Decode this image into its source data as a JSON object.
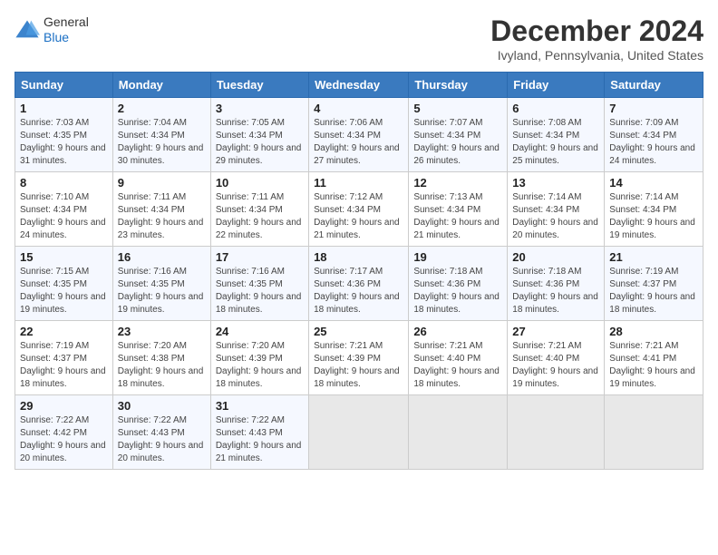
{
  "header": {
    "logo_line1": "General",
    "logo_line2": "Blue",
    "title": "December 2024",
    "subtitle": "Ivyland, Pennsylvania, United States"
  },
  "days_of_week": [
    "Sunday",
    "Monday",
    "Tuesday",
    "Wednesday",
    "Thursday",
    "Friday",
    "Saturday"
  ],
  "weeks": [
    [
      {
        "day": "1",
        "sunrise": "7:03 AM",
        "sunset": "4:35 PM",
        "daylight": "9 hours and 31 minutes."
      },
      {
        "day": "2",
        "sunrise": "7:04 AM",
        "sunset": "4:34 PM",
        "daylight": "9 hours and 30 minutes."
      },
      {
        "day": "3",
        "sunrise": "7:05 AM",
        "sunset": "4:34 PM",
        "daylight": "9 hours and 29 minutes."
      },
      {
        "day": "4",
        "sunrise": "7:06 AM",
        "sunset": "4:34 PM",
        "daylight": "9 hours and 27 minutes."
      },
      {
        "day": "5",
        "sunrise": "7:07 AM",
        "sunset": "4:34 PM",
        "daylight": "9 hours and 26 minutes."
      },
      {
        "day": "6",
        "sunrise": "7:08 AM",
        "sunset": "4:34 PM",
        "daylight": "9 hours and 25 minutes."
      },
      {
        "day": "7",
        "sunrise": "7:09 AM",
        "sunset": "4:34 PM",
        "daylight": "9 hours and 24 minutes."
      }
    ],
    [
      {
        "day": "8",
        "sunrise": "7:10 AM",
        "sunset": "4:34 PM",
        "daylight": "9 hours and 24 minutes."
      },
      {
        "day": "9",
        "sunrise": "7:11 AM",
        "sunset": "4:34 PM",
        "daylight": "9 hours and 23 minutes."
      },
      {
        "day": "10",
        "sunrise": "7:11 AM",
        "sunset": "4:34 PM",
        "daylight": "9 hours and 22 minutes."
      },
      {
        "day": "11",
        "sunrise": "7:12 AM",
        "sunset": "4:34 PM",
        "daylight": "9 hours and 21 minutes."
      },
      {
        "day": "12",
        "sunrise": "7:13 AM",
        "sunset": "4:34 PM",
        "daylight": "9 hours and 21 minutes."
      },
      {
        "day": "13",
        "sunrise": "7:14 AM",
        "sunset": "4:34 PM",
        "daylight": "9 hours and 20 minutes."
      },
      {
        "day": "14",
        "sunrise": "7:14 AM",
        "sunset": "4:34 PM",
        "daylight": "9 hours and 19 minutes."
      }
    ],
    [
      {
        "day": "15",
        "sunrise": "7:15 AM",
        "sunset": "4:35 PM",
        "daylight": "9 hours and 19 minutes."
      },
      {
        "day": "16",
        "sunrise": "7:16 AM",
        "sunset": "4:35 PM",
        "daylight": "9 hours and 19 minutes."
      },
      {
        "day": "17",
        "sunrise": "7:16 AM",
        "sunset": "4:35 PM",
        "daylight": "9 hours and 18 minutes."
      },
      {
        "day": "18",
        "sunrise": "7:17 AM",
        "sunset": "4:36 PM",
        "daylight": "9 hours and 18 minutes."
      },
      {
        "day": "19",
        "sunrise": "7:18 AM",
        "sunset": "4:36 PM",
        "daylight": "9 hours and 18 minutes."
      },
      {
        "day": "20",
        "sunrise": "7:18 AM",
        "sunset": "4:36 PM",
        "daylight": "9 hours and 18 minutes."
      },
      {
        "day": "21",
        "sunrise": "7:19 AM",
        "sunset": "4:37 PM",
        "daylight": "9 hours and 18 minutes."
      }
    ],
    [
      {
        "day": "22",
        "sunrise": "7:19 AM",
        "sunset": "4:37 PM",
        "daylight": "9 hours and 18 minutes."
      },
      {
        "day": "23",
        "sunrise": "7:20 AM",
        "sunset": "4:38 PM",
        "daylight": "9 hours and 18 minutes."
      },
      {
        "day": "24",
        "sunrise": "7:20 AM",
        "sunset": "4:39 PM",
        "daylight": "9 hours and 18 minutes."
      },
      {
        "day": "25",
        "sunrise": "7:21 AM",
        "sunset": "4:39 PM",
        "daylight": "9 hours and 18 minutes."
      },
      {
        "day": "26",
        "sunrise": "7:21 AM",
        "sunset": "4:40 PM",
        "daylight": "9 hours and 18 minutes."
      },
      {
        "day": "27",
        "sunrise": "7:21 AM",
        "sunset": "4:40 PM",
        "daylight": "9 hours and 19 minutes."
      },
      {
        "day": "28",
        "sunrise": "7:21 AM",
        "sunset": "4:41 PM",
        "daylight": "9 hours and 19 minutes."
      }
    ],
    [
      {
        "day": "29",
        "sunrise": "7:22 AM",
        "sunset": "4:42 PM",
        "daylight": "9 hours and 20 minutes."
      },
      {
        "day": "30",
        "sunrise": "7:22 AM",
        "sunset": "4:43 PM",
        "daylight": "9 hours and 20 minutes."
      },
      {
        "day": "31",
        "sunrise": "7:22 AM",
        "sunset": "4:43 PM",
        "daylight": "9 hours and 21 minutes."
      },
      null,
      null,
      null,
      null
    ]
  ],
  "labels": {
    "sunrise": "Sunrise:",
    "sunset": "Sunset:",
    "daylight": "Daylight:"
  }
}
